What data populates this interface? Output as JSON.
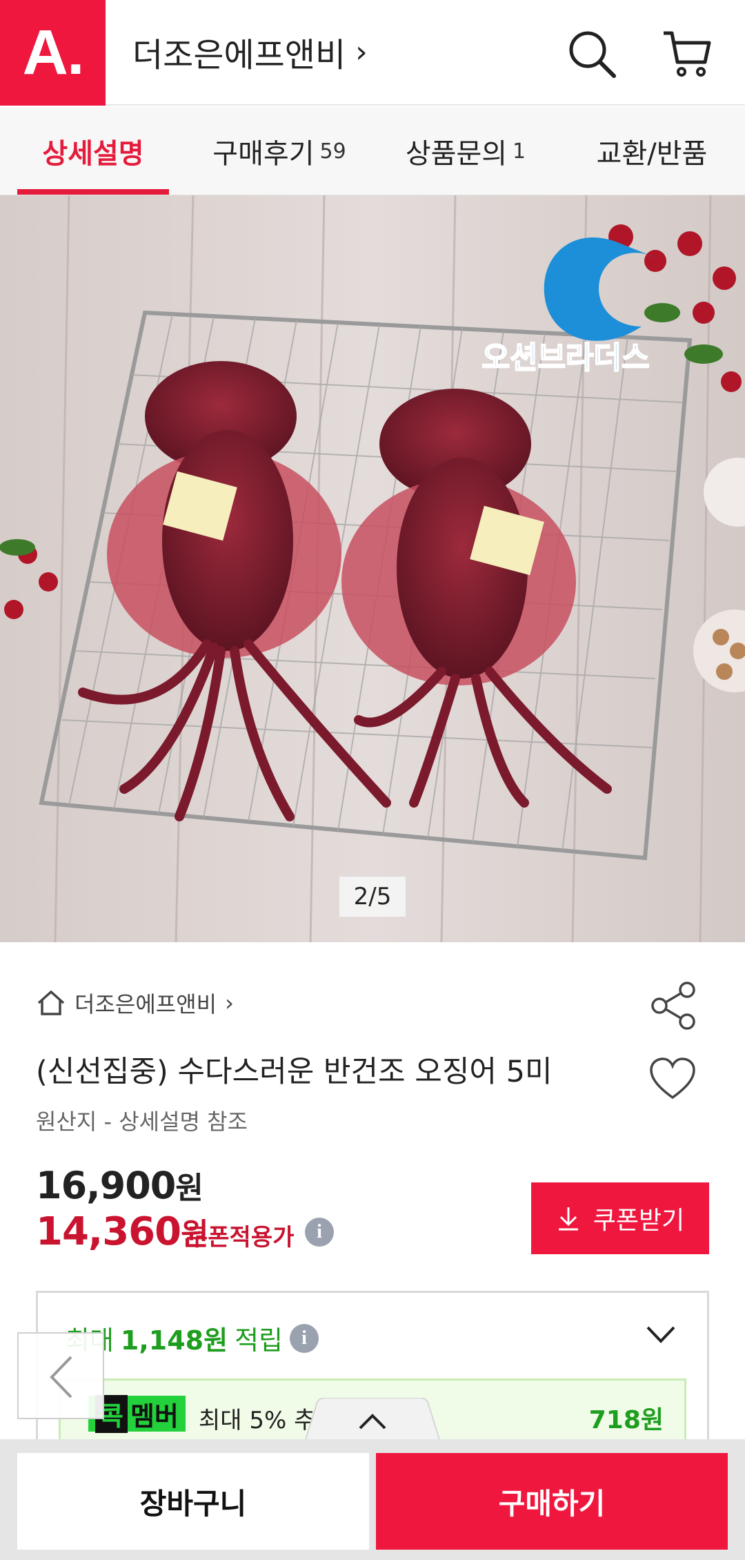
{
  "header": {
    "logo_text": "A.",
    "store_name": "더조은에프앤비",
    "store_chevron": "›",
    "search_icon": "search-icon",
    "cart_icon": "cart-icon"
  },
  "tabs": [
    {
      "label": "상세설명",
      "count": "",
      "active": true
    },
    {
      "label": "구매후기",
      "count": "59",
      "active": false
    },
    {
      "label": "상품문의",
      "count": "1",
      "active": false
    },
    {
      "label": "교환/반품",
      "count": "",
      "active": false
    }
  ],
  "gallery": {
    "counter": "2/5",
    "brand_logo_text": "오션브라더스"
  },
  "product": {
    "breadcrumb": "더조은에프앤비",
    "title": "(신선집중) 수다스러운 반건조 오징어 5미",
    "origin": "원산지 - 상세설명 참조",
    "original_price": "16,900",
    "original_unit": "원",
    "sale_price": "14,360",
    "sale_unit": "원",
    "coupon_label": "쿠폰적용가",
    "coupon_button": "쿠폰받기"
  },
  "reward": {
    "prefix": "최대",
    "amount": "1,148원",
    "suffix": "적립",
    "member_badge_k": "콕",
    "member_badge": "멤버",
    "member_text": "최대 5% 추",
    "member_amount": "718원"
  },
  "bottom": {
    "cart_label": "장바구니",
    "buy_label": "구매하기"
  },
  "colors": {
    "brand_red": "#f0173f",
    "price_red": "#c9132f",
    "reward_green": "#1e9e1e"
  }
}
